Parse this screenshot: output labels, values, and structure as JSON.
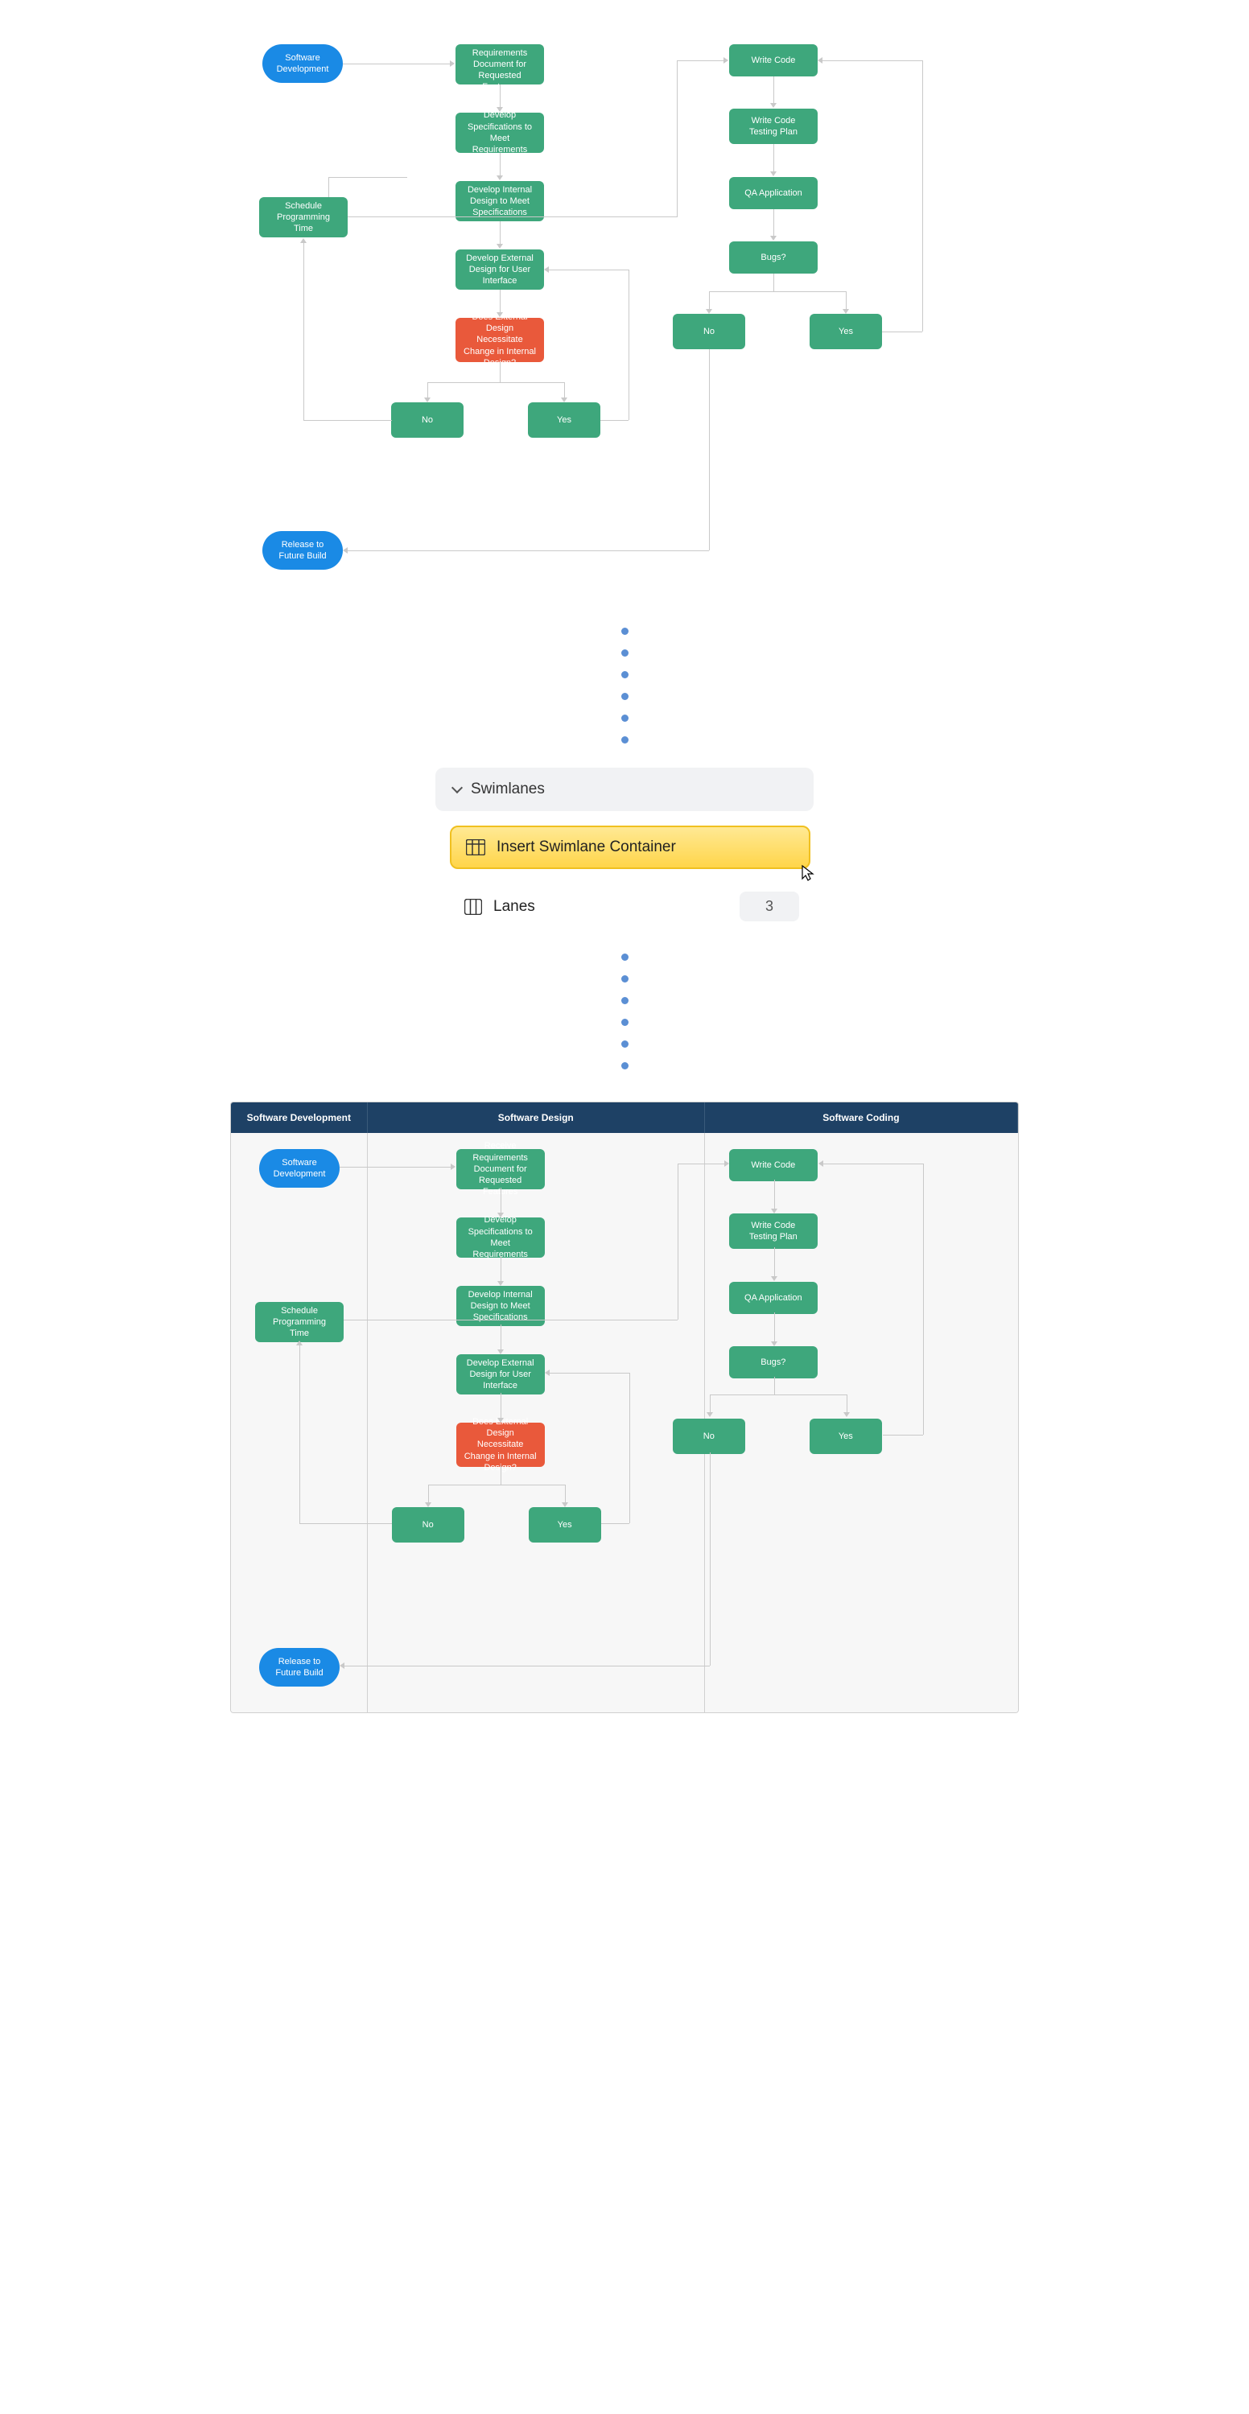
{
  "panel": {
    "header": "Swimlanes",
    "button": "Insert Swimlane Container",
    "lanes_label": "Lanes",
    "lanes_value": "3"
  },
  "swimlanes": {
    "headers": [
      "Software Development",
      "Software Design",
      "Software Coding"
    ]
  },
  "nodes": {
    "start": "Software Development",
    "receive": "Receive Requirements Document for Requested Features",
    "spec": "Develop Specifications to Meet Requirements",
    "internal": "Develop Internal Design to Meet Specifications",
    "external": "Develop External Design for User Interface",
    "decision1": "Does External Design Necessitate Change in Internal Design?",
    "no1": "No",
    "yes1": "Yes",
    "schedule": "Schedule Programming Time",
    "write": "Write Code",
    "testplan": "Write Code Testing Plan",
    "qa": "QA Application",
    "bugs": "Bugs?",
    "no2": "No",
    "yes2": "Yes",
    "release": "Release to Future Build"
  }
}
